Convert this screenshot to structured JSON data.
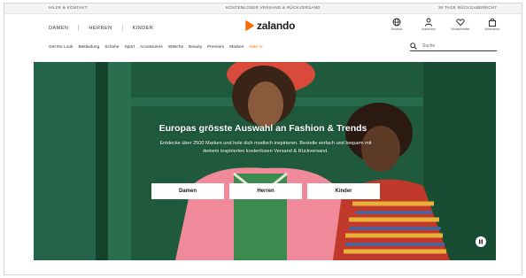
{
  "topbar": {
    "left": "Hilfe & Kontakt",
    "center": "Kostenloser Versand & Rückversand",
    "right": "30 Tage Rückgaberecht"
  },
  "gender_nav": [
    "DAMEN",
    "HERREN",
    "KINDER"
  ],
  "logo": {
    "text": "zalando",
    "accent": "#ff6900"
  },
  "account_icons": [
    {
      "icon": "globe-icon",
      "label": "Deutsch"
    },
    {
      "icon": "user-icon",
      "label": "Anmelden"
    },
    {
      "icon": "heart-icon",
      "label": "Wunschzettel"
    },
    {
      "icon": "bag-icon",
      "label": "Warenkorb"
    }
  ],
  "category_nav": [
    "Get the Look",
    "Bekleidung",
    "Schuhe",
    "Sport",
    "Accessoires",
    "Wäsche",
    "Beauty",
    "Premium",
    "Marken",
    "Sale %"
  ],
  "search": {
    "placeholder": "Suche"
  },
  "hero": {
    "headline": "Europas grösste Auswahl an Fashion & Trends",
    "subline": "Entdecke über 2500 Marken und hole dich modisch inspirieren. Bestelle einfach und bequem mit deinem inspirierten kostenlosen Versand & Rückversand.",
    "buttons": [
      "Damen",
      "Herren",
      "Kinder"
    ]
  },
  "colors": {
    "sale": "#ff6900",
    "hero_green": "#1f5a3c"
  }
}
